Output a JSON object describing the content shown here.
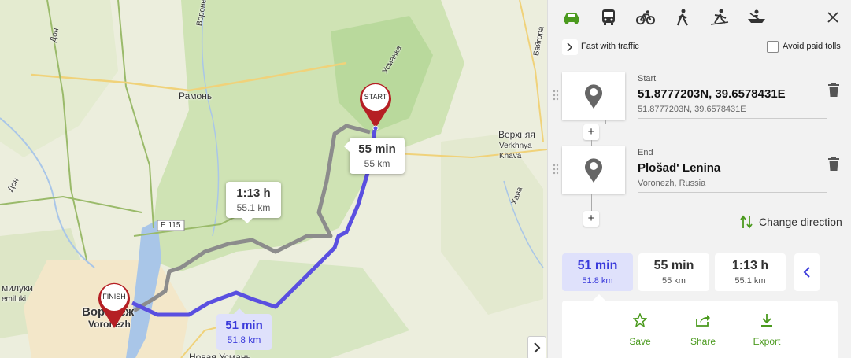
{
  "map": {
    "labels": {
      "ramon": "Рамонь",
      "verkhnyaya": "Верхняя",
      "verkhnya_lat": "Verkhnya",
      "khava": "Khava",
      "voronezh_river": "Воронеж",
      "don": "Дон",
      "don2": "Дон",
      "khava_river": "Хава",
      "baigora": "Байгора",
      "semiluki": "милуки",
      "semiluki_lat": "emiluki",
      "voronezh_city": "Воронеж",
      "voronezh_lat": "Voronezh",
      "novaya_usman": "Новая Усмань",
      "road_e115": "E 115",
      "road_river": "Усманка"
    },
    "bubbles": {
      "b55": {
        "time": "55 min",
        "dist": "55 km"
      },
      "b113": {
        "time": "1:13 h",
        "dist": "55.1 km"
      },
      "b51": {
        "time": "51 min",
        "dist": "51.8 km"
      }
    },
    "pins": {
      "start": "START",
      "finish": "FINISH"
    },
    "route_color": "#5a4fe0",
    "alt_route_color": "#8c8c8c"
  },
  "panel": {
    "modes": [
      "car-icon",
      "bus-icon",
      "bicycle-icon",
      "walking-icon",
      "skiing-icon",
      "boat-icon"
    ],
    "active_mode": "car-icon",
    "active_color": "#4b9a1e",
    "option_label": "Fast with traffic",
    "avoid_tolls_label": "Avoid paid tolls",
    "avoid_tolls_checked": false,
    "start": {
      "label": "Start",
      "name": "51.8777203N, 39.6578431E",
      "sub": "51.8777203N, 39.6578431E"
    },
    "end": {
      "label": "End",
      "name": "Plošad' Lenina",
      "sub": "Voronezh, Russia"
    },
    "change_direction": "Change direction",
    "routes": [
      {
        "time": "51 min",
        "dist": "51.8 km",
        "selected": true
      },
      {
        "time": "55 min",
        "dist": "55 km",
        "selected": false
      },
      {
        "time": "1:13 h",
        "dist": "55.1 km",
        "selected": false
      }
    ],
    "actions": {
      "save": "Save",
      "share": "Share",
      "export": "Export"
    }
  }
}
